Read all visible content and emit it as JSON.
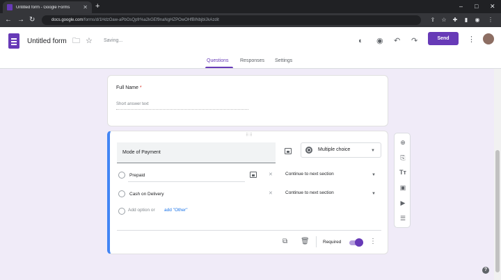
{
  "browser": {
    "tab_title": "Untitled form - Google Forms",
    "tab_close": "✕",
    "new_tab": "+",
    "url_host": "docs.google.com",
    "url_path": "/forms/d/1HdzOaw-aPbOsQpfr%a2kGEf9naNgHZPOwOHfBINbjbIJkAzdit",
    "win_min": "–",
    "win_max": "□",
    "win_close": "✕",
    "nav_back": "←",
    "nav_forward": "→",
    "nav_reload": "↻"
  },
  "header": {
    "form_title": "Untitled form",
    "status": "Saving...",
    "send_label": "Send",
    "icons": [
      "palette-icon",
      "preview-icon",
      "undo-icon",
      "redo-icon",
      "more-vert-icon"
    ]
  },
  "tabs": [
    {
      "label": "Questions",
      "active": true
    },
    {
      "label": "Responses",
      "active": false
    },
    {
      "label": "Settings",
      "active": false
    }
  ],
  "question1": {
    "title": "Full Name",
    "required_mark": "*",
    "hint": "Short answer text"
  },
  "question2": {
    "title": "Mode of Payment",
    "type": "Multiple choice",
    "options": [
      {
        "label": "Prepaid",
        "goto": "Continue to next section"
      },
      {
        "label": "Cash on Delivery",
        "goto": "Continue to next section"
      }
    ],
    "add_option": "Add option",
    "or": "or",
    "add_other": "add \"Other\"",
    "required_label": "Required",
    "required_on": true
  },
  "toolbar": {
    "items": [
      "add-question-icon",
      "import-questions-icon",
      "add-title-icon",
      "add-image-icon",
      "add-video-icon",
      "add-section-icon"
    ]
  },
  "help_label": "?",
  "colors": {
    "accent": "#673ab7",
    "page_bg": "#f0ebf8",
    "active_card_border": "#4285f4"
  }
}
